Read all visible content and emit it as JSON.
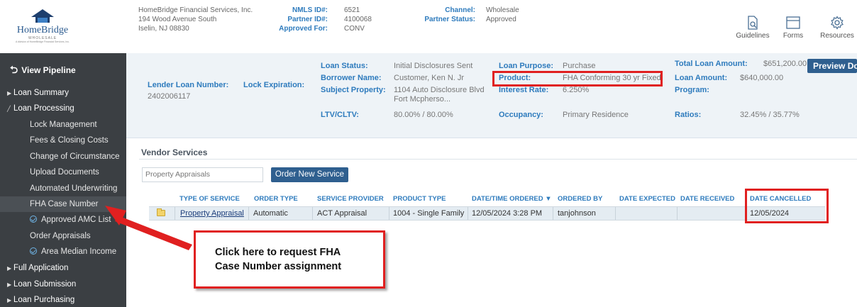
{
  "header": {
    "logo": {
      "name": "HomeBridge",
      "sub": "WHOLESALE",
      "tag": "A division of HomeBridge Financial Services, Inc."
    },
    "company": [
      "HomeBridge Financial Services, Inc.",
      "194 Wood Avenue South",
      "Iselin, NJ 08830"
    ],
    "nmls": {
      "labels": [
        "NMLS ID#:",
        "Partner ID#:",
        "Approved For:"
      ],
      "values": [
        "6521",
        "4100068",
        "CONV"
      ]
    },
    "channel": {
      "labels": [
        "Channel:",
        "Partner Status:"
      ],
      "values": [
        "Wholesale",
        "Approved"
      ]
    },
    "tools": [
      "Guidelines",
      "Forms",
      "Resources"
    ]
  },
  "sidebar": {
    "view_pipeline": "View Pipeline",
    "items": [
      "Loan Summary",
      "Loan Processing",
      "Lock Management",
      "Fees & Closing Costs",
      "Change of Circumstance",
      "Upload Documents",
      "Automated Underwriting",
      "FHA Case Number",
      "Approved AMC List",
      "Order Appraisals",
      "Area Median Income",
      "Full Application",
      "Loan Submission",
      "Loan Purchasing"
    ]
  },
  "loan": {
    "lender_loan_number_label": "Lender Loan Number:",
    "lender_loan_number": "2402006117",
    "lock_expiration_label": "Lock Expiration:",
    "loan_status_label": "Loan Status:",
    "loan_status": "Initial Disclosures Sent",
    "borrower_name_label": "Borrower Name:",
    "borrower_name": "Customer, Ken N. Jr",
    "subject_property_label": "Subject Property:",
    "subject_property_1": "1104 Auto Disclosure Blvd",
    "subject_property_2": "Fort Mcpherso...",
    "ltv_label": "LTV/CLTV:",
    "ltv": "80.00% / 80.00%",
    "loan_purpose_label": "Loan Purpose:",
    "loan_purpose": "Purchase",
    "product_label": "Product:",
    "product": "FHA Conforming 30 yr Fixed",
    "interest_rate_label": "Interest Rate:",
    "interest_rate": "6.250%",
    "occupancy_label": "Occupancy:",
    "occupancy": "Primary Residence",
    "total_loan_amount_label": "Total Loan Amount:",
    "total_loan_amount": "$651,200.00",
    "loan_amount_label": "Loan Amount:",
    "loan_amount": "$640,000.00",
    "program_label": "Program:",
    "ratios_label": "Ratios:",
    "ratios": "32.45% / 35.77%",
    "preview_docs": "Preview Docs"
  },
  "vendor": {
    "title": "Vendor Services",
    "service_select": "Property Appraisals",
    "order_button": "Order New Service",
    "columns": [
      "TYPE OF SERVICE",
      "ORDER TYPE",
      "SERVICE PROVIDER",
      "PRODUCT TYPE",
      "DATE/TIME ORDERED",
      "ORDERED BY",
      "DATE EXPECTED",
      "DATE RECEIVED",
      "DATE CANCELLED"
    ],
    "rows": [
      [
        "Property Appraisal",
        "Automatic",
        "ACT Appraisal",
        "1004 - Single Family",
        "12/05/2024 3:28 PM",
        "tanjohnson",
        "",
        "",
        "12/05/2024"
      ]
    ]
  },
  "annotation": {
    "callout_line1": "Click here to request FHA",
    "callout_line2": "Case Number assignment"
  },
  "colors": {
    "accent": "#2e7bbd",
    "sidebar": "#3b3f43",
    "button": "#2f5f8f",
    "highlight": "#e02020"
  }
}
